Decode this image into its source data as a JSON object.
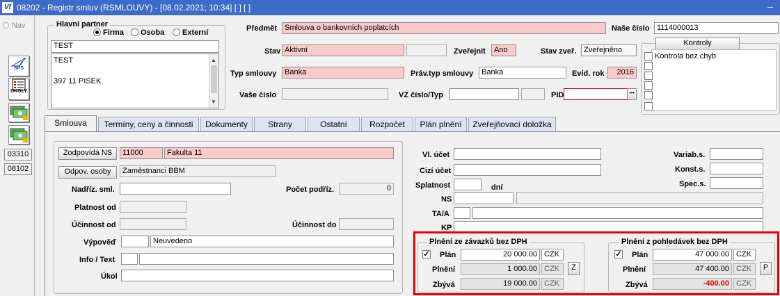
{
  "window": {
    "logo": "Vf",
    "title": "08202 - Registr smluv (RSMLOUVY) - [08.02.2021; 10:34] [ ] [ ]",
    "control": "–"
  },
  "rail": {
    "nav_label": "Nav",
    "icons": [
      {
        "name": "sps-icon",
        "caption": "SPS"
      },
      {
        "name": "ukoly-icon",
        "caption": "ÚKOLY"
      },
      {
        "name": "money-icon",
        "caption": ""
      },
      {
        "name": "money-icon-2",
        "caption": ""
      }
    ],
    "buttons": [
      "03310",
      "08102"
    ]
  },
  "partner": {
    "legend": "Hlavní partner",
    "radios": [
      {
        "label": "Firma",
        "selected": true
      },
      {
        "label": "Osoba",
        "selected": false
      },
      {
        "label": "Externí",
        "selected": false
      }
    ],
    "name": "TEST",
    "address_lines": [
      "TEST",
      "",
      "397 11 PISEK"
    ]
  },
  "header": {
    "predmet_label": "Předmět",
    "predmet_value": "Smlouva o bankovních poplatcích",
    "nase_cislo_label": "Naše číslo",
    "nase_cislo_value": "1114000013",
    "stav_label": "Stav",
    "stav_value": "Aktivní",
    "zverejnit_label": "Zveřejnit",
    "zverejnit_value": "Ano",
    "stav_zver_label": "Stav zveř.",
    "stav_zver_value": "Zveřejněno",
    "typ_label": "Typ smlouvy",
    "typ_value": "Banka",
    "prav_typ_label": "Práv.typ smlouvy",
    "prav_typ_value": "Banka",
    "evid_rok_label": "Evid. rok",
    "evid_rok_value": "2016",
    "vase_cislo_label": "Vaše číslo",
    "vase_cislo_value": "",
    "vz_label": "VZ číslo/Typ",
    "pid_label": "PID",
    "pid_button": "•••"
  },
  "kontroly": {
    "button": "Kontroly",
    "items": [
      {
        "label": "Kontrola bez chyb",
        "checked": false
      },
      {
        "label": "",
        "checked": false
      },
      {
        "label": "",
        "checked": false
      },
      {
        "label": "",
        "checked": false
      },
      {
        "label": "",
        "checked": false
      },
      {
        "label": "",
        "checked": false
      }
    ]
  },
  "tabs": [
    "Smlouva",
    "Termíny, ceny a činnosti",
    "Dokumenty",
    "Strany",
    "Ostatní",
    "Rozpočet",
    "Plán plnění",
    "Zveřejňovací doložka"
  ],
  "left": {
    "zodpovida_button": "Zodpovídá NS",
    "ns_code": "11000",
    "ns_name": "Fakulta 11",
    "odpov_button": "Odpov. osoby",
    "odpov_value": "Zaměstnanci BBM",
    "nadriz_label": "Nadříz. sml.",
    "pocet_label": "Počet podříz.",
    "pocet_value": "0",
    "platnost_label": "Platnost od",
    "ucinnost_od_label": "Účinnost od",
    "ucinnost_do_label": "Účinnost do",
    "vypoved_label": "Výpověď",
    "vypoved_value": "Neuvedeno",
    "info_label": "Info / Text",
    "ukol_label": "Úkol"
  },
  "right": {
    "vl_ucet_label": "Vl. účet",
    "cizi_ucet_label": "Cizí účet",
    "splatnost_label": "Splatnost",
    "dni_label": "dní",
    "ns_label": "NS",
    "taa_label": "TA/A",
    "kp_label": "KP",
    "variab_label": "Variab.s.",
    "konst_label": "Konst.s.",
    "spec_label": "Spec.s."
  },
  "plneni_zavazku": {
    "legend": "Plnění ze závazků bez DPH",
    "plan_checked": true,
    "plan_label": "Plán",
    "plan_value": "20 000.00",
    "plneni_label": "Plnění",
    "plneni_value": "1 000.00",
    "zbyva_label": "Zbývá",
    "zbyva_value": "19 000.00",
    "currency": "CZK",
    "button": "Z"
  },
  "plneni_pohledavek": {
    "legend": "Plnění z pohledávek bez DPH",
    "plan_checked": true,
    "plan_label": "Plán",
    "plan_value": "47 000.00",
    "plneni_label": "Plnění",
    "plneni_value": "47 400.00",
    "zbyva_label": "Zbývá",
    "zbyva_value": "-400.00",
    "currency": "CZK",
    "button": "P"
  },
  "colors": {
    "title_bar": "#3d6bc8",
    "pink_field": "#fbcaca",
    "highlight_border": "#e40000",
    "negative_value": "#e40000"
  }
}
